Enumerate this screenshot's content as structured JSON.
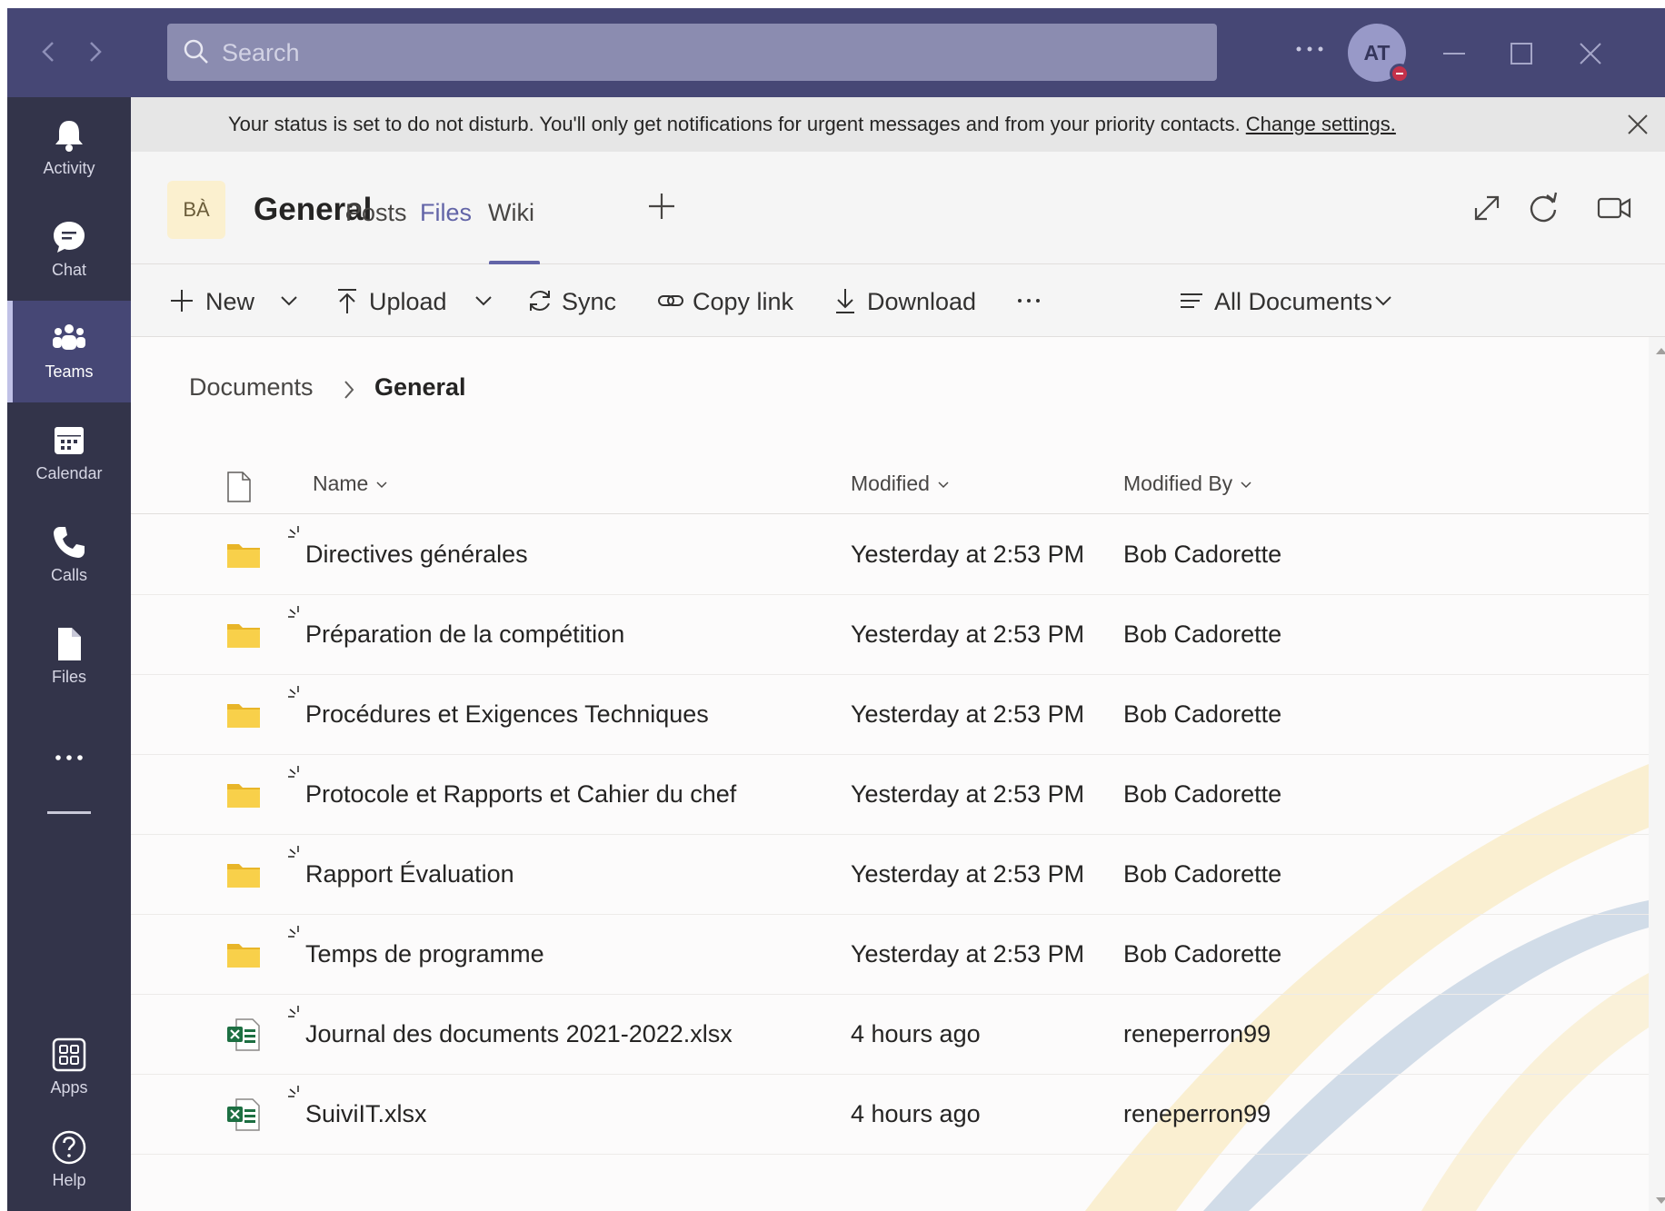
{
  "titlebar": {
    "search_placeholder": "Search",
    "avatar_initials": "AT"
  },
  "rail": {
    "items": [
      {
        "label": "Activity",
        "icon": "bell-icon"
      },
      {
        "label": "Chat",
        "icon": "chat-icon"
      },
      {
        "label": "Teams",
        "icon": "teams-icon",
        "active": true
      },
      {
        "label": "Calendar",
        "icon": "calendar-icon"
      },
      {
        "label": "Calls",
        "icon": "phone-icon"
      },
      {
        "label": "Files",
        "icon": "file-icon"
      }
    ],
    "bottom": [
      {
        "label": "Apps",
        "icon": "apps-icon"
      },
      {
        "label": "Help",
        "icon": "help-icon"
      }
    ]
  },
  "banner": {
    "message": "Your status is set to do not disturb. You'll only get notifications for urgent messages and from your priority contacts.",
    "link": "Change settings."
  },
  "channel": {
    "team_initials": "BÀ",
    "title": "General",
    "tabs": [
      "Posts",
      "Files",
      "Wiki"
    ],
    "active_tab": "Files"
  },
  "commands": {
    "new": "New",
    "upload": "Upload",
    "sync": "Sync",
    "copy_link": "Copy link",
    "download": "Download",
    "view": "All Documents"
  },
  "breadcrumb": {
    "root": "Documents",
    "current": "General"
  },
  "columns": {
    "name": "Name",
    "modified": "Modified",
    "modified_by": "Modified By"
  },
  "files": [
    {
      "name": "Directives générales",
      "type": "folder",
      "modified": "Yesterday at 2:53 PM",
      "by": "Bob Cadorette"
    },
    {
      "name": "Préparation de la compétition",
      "type": "folder",
      "modified": "Yesterday at 2:53 PM",
      "by": "Bob Cadorette"
    },
    {
      "name": "Procédures et Exigences Techniques",
      "type": "folder",
      "modified": "Yesterday at 2:53 PM",
      "by": "Bob Cadorette"
    },
    {
      "name": "Protocole et Rapports et Cahier du chef",
      "type": "folder",
      "modified": "Yesterday at 2:53 PM",
      "by": "Bob Cadorette"
    },
    {
      "name": "Rapport Évaluation",
      "type": "folder",
      "modified": "Yesterday at 2:53 PM",
      "by": "Bob Cadorette"
    },
    {
      "name": "Temps de programme",
      "type": "folder",
      "modified": "Yesterday at 2:53 PM",
      "by": "Bob Cadorette"
    },
    {
      "name": "Journal des documents 2021-2022.xlsx",
      "type": "excel",
      "modified": "4 hours ago",
      "by": "reneperron99"
    },
    {
      "name": "SuiviIT.xlsx",
      "type": "excel",
      "modified": "4 hours ago",
      "by": "reneperron99"
    }
  ],
  "colors": {
    "titlebar": "#464775",
    "rail": "#33344a",
    "accent": "#6264a7",
    "folder": "#f8d04a",
    "excel": "#1d6f42"
  }
}
